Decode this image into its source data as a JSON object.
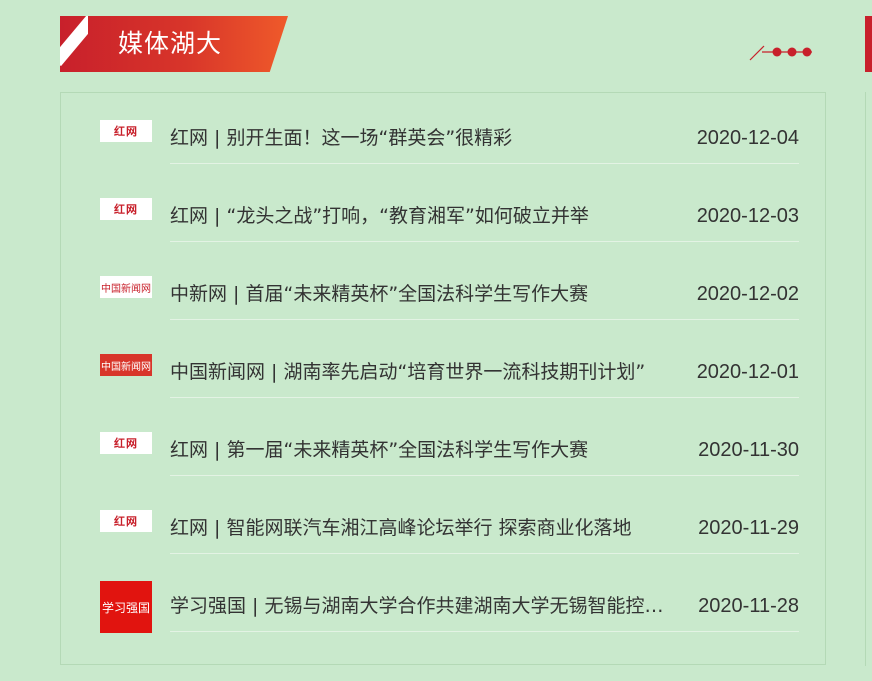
{
  "header": {
    "title": "媒体湖大"
  },
  "colors": {
    "accent": "#c8202b",
    "background": "#c9e9cc",
    "text": "#333333"
  },
  "news": [
    {
      "source_logo": "红网",
      "logo_type": "hongwang",
      "title": "红网 | 别开生面！这一场“群英会”很精彩",
      "date": "2020-12-04"
    },
    {
      "source_logo": "红网",
      "logo_type": "hongwang",
      "title": "红网 | “龙头之战”打响，“教育湘军”如何破立并举",
      "date": "2020-12-03"
    },
    {
      "source_logo": "中国新闻网",
      "logo_type": "chinanews",
      "title": "中新网 | 首届“未来精英杯”全国法科学生写作大赛",
      "date": "2020-12-02"
    },
    {
      "source_logo": "中国新闻网",
      "logo_type": "chinanews-red",
      "title": "中国新闻网 | 湖南率先启动“培育世界一流科技期刊计划”",
      "date": "2020-12-01"
    },
    {
      "source_logo": "红网",
      "logo_type": "hongwang",
      "title": "红网 | 第一届“未来精英杯”全国法科学生写作大赛",
      "date": "2020-11-30"
    },
    {
      "source_logo": "红网",
      "logo_type": "hongwang",
      "title": "红网 | 智能网联汽车湘江高峰论坛举行 探索商业化落地",
      "date": "2020-11-29"
    },
    {
      "source_logo": "学习强国",
      "logo_type": "xuexi",
      "title": "学习强国 | 无锡与湖南大学合作共建湖南大学无锡智能控制研究院",
      "date": "2020-11-28"
    }
  ]
}
